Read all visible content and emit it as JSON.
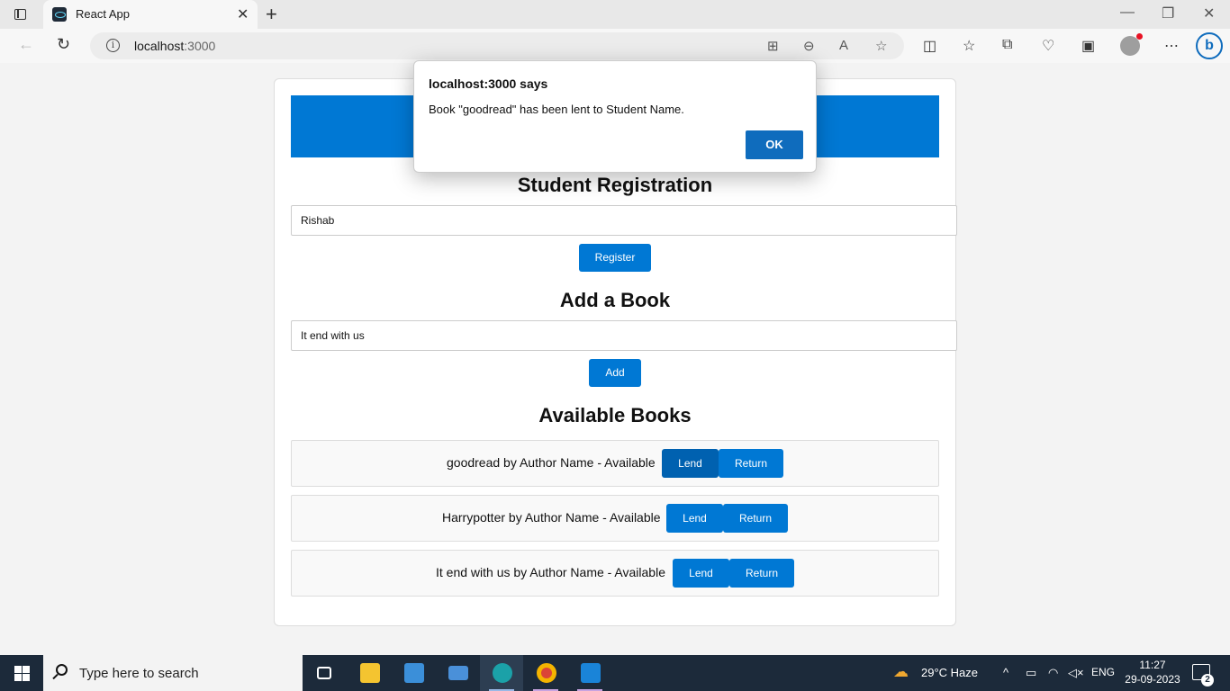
{
  "browser": {
    "tab_title": "React App",
    "url_host": "localhost",
    "url_port": ":3000"
  },
  "dialog": {
    "title": "localhost:3000 says",
    "message": "Book \"goodread\" has been lent to Student Name.",
    "ok_label": "OK"
  },
  "registration": {
    "title": "Student Registration",
    "input_value": "Rishab",
    "button_label": "Register"
  },
  "add_book": {
    "title": "Add a Book",
    "input_value": "It end with us",
    "button_label": "Add"
  },
  "books": {
    "title": "Available Books",
    "items": [
      {
        "text": "goodread by Author Name - Available",
        "lend": "Lend",
        "return": "Return"
      },
      {
        "text": "Harrypotter by Author Name - Available",
        "lend": "Lend",
        "return": "Return"
      },
      {
        "text": "It end with us by Author Name - Available",
        "lend": "Lend",
        "return": "Return"
      }
    ]
  },
  "taskbar": {
    "search_placeholder": "Type here to search",
    "weather": "29°C  Haze",
    "language": "ENG",
    "time": "11:27",
    "date": "29-09-2023",
    "notifications": "2"
  }
}
